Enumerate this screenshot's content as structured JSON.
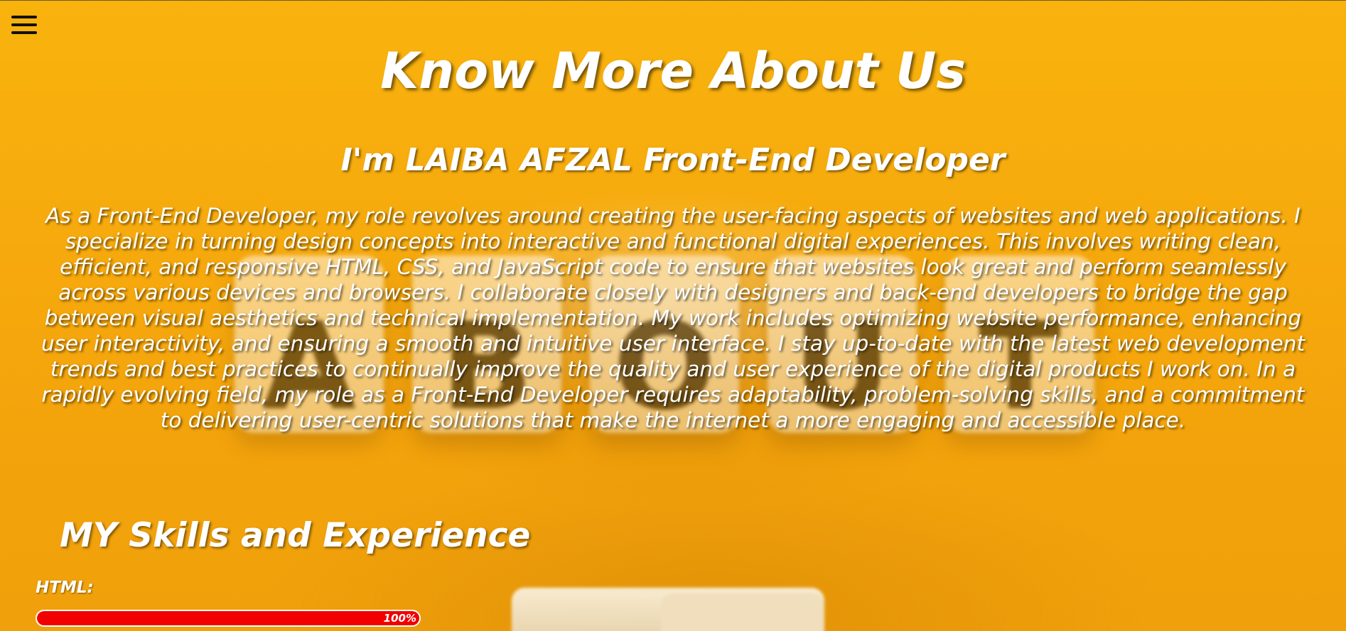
{
  "header": {
    "menu_icon": "hamburger-menu-icon"
  },
  "about": {
    "title": "Know More About Us",
    "intro_heading": "I'm LAIBA AFZAL Front-End Developer",
    "paragraph": "As a Front-End Developer, my role revolves around creating the user-facing aspects of websites and web applications. I specialize in turning design concepts into interactive and functional digital experiences. This involves writing clean, efficient, and responsive HTML, CSS, and JavaScript code to ensure that websites look great and perform seamlessly across various devices and browsers. I collaborate closely with designers and back-end developers to bridge the gap between visual aesthetics and technical implementation. My work includes optimizing website performance, enhancing user interactivity, and ensuring a smooth and intuitive user interface. I stay up-to-date with the latest web development trends and best practices to continually improve the quality and user experience of the digital products I work on. In a rapidly evolving field, my role as a Front-End Developer requires adaptability, problem-solving skills, and a commitment to delivering user-centric solutions that make the internet a more engaging and accessible place."
  },
  "background": {
    "letters": [
      "A",
      "B",
      "O",
      "U",
      "T"
    ]
  },
  "skills": {
    "heading": "MY Skills and Experience",
    "items": [
      {
        "label": "HTML:",
        "percent_text": "100%",
        "percent": 100
      }
    ]
  },
  "colors": {
    "background": "#f7ab0d",
    "text": "#ffffff",
    "progress_fill": "#f20000",
    "menu_icon": "#111111"
  }
}
